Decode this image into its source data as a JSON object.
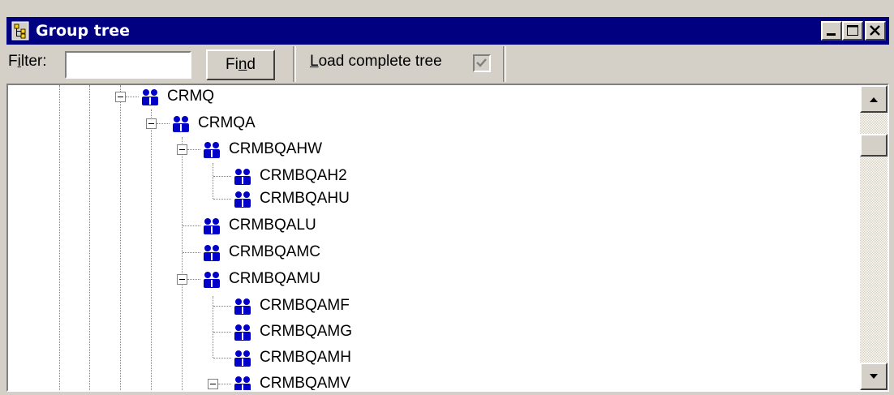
{
  "window": {
    "title": "Group tree",
    "title_icon": "group-tree-app-icon",
    "controls": [
      "minimize",
      "maximize",
      "close"
    ]
  },
  "toolbar": {
    "filter_label_pre": "F",
    "filter_label_ul": "i",
    "filter_label_post": "lter:",
    "filter_value": "",
    "find_label_pre": "Fi",
    "find_label_ul": "n",
    "find_label_post": "d",
    "load_label_ul": "L",
    "load_label_post": "oad complete tree",
    "load_checked": true
  },
  "tree": {
    "nodes": [
      {
        "label": "CRMQ",
        "expanded": true
      },
      {
        "label": "CRMQA",
        "expanded": true
      },
      {
        "label": "CRMBQAHW",
        "expanded": true
      },
      {
        "label": "CRMBQAH2"
      },
      {
        "label": "CRMBQAHU"
      },
      {
        "label": "CRMBQALU"
      },
      {
        "label": "CRMBQAMC"
      },
      {
        "label": "CRMBQAMU",
        "expanded": true
      },
      {
        "label": "CRMBQAMF"
      },
      {
        "label": "CRMBQAMG"
      },
      {
        "label": "CRMBQAMH"
      },
      {
        "label": "CRMBQAMV",
        "expanded": true
      }
    ]
  },
  "colors": {
    "titlebar": "#000080",
    "face": "#d4d0c8",
    "group_icon": "#0000c8"
  }
}
